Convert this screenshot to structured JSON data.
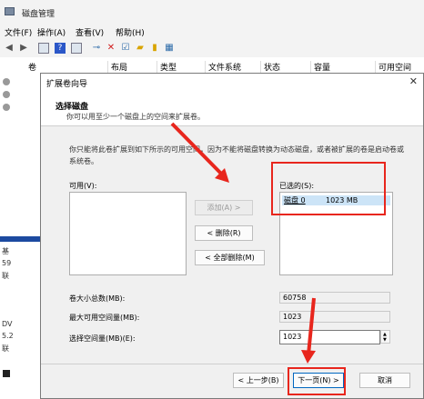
{
  "window": {
    "title": "磁盘管理"
  },
  "menu": [
    "文件(F)",
    "操作(A)",
    "查看(V)",
    "帮助(H)"
  ],
  "toolbar_icons": [
    "back-arrow-icon",
    "forward-arrow-icon",
    "properties-icon",
    "help-icon",
    "connect-icon",
    "delete-icon",
    "check-icon",
    "folder-icon",
    "open-icon",
    "info-icon"
  ],
  "columns": [
    "卷",
    "布局",
    "类型",
    "文件系统",
    "状态",
    "容量",
    "可用空间"
  ],
  "left_pane": {
    "labels": [
      "基",
      "59",
      "联",
      "DV",
      "5.2",
      "联"
    ]
  },
  "dialog": {
    "title": "扩展卷向导",
    "close": "✕",
    "header_title": "选择磁盘",
    "header_sub": "你可以用至少一个磁盘上的空间来扩展卷。",
    "description": "你只能将此卷扩展到如下所示的可用空间，因为不能将磁盘转换为动态磁盘，或者被扩展的卷是启动卷或系统卷。",
    "available_label": "可用(V):",
    "selected_label": "已选的(S):",
    "selected_items": [
      {
        "disk": "磁盘 0",
        "size": "1023 MB"
      }
    ],
    "add_button": "添加(A) >",
    "remove_button": "< 删除(R)",
    "remove_all_button": "< 全部删除(M)",
    "total_label": "卷大小总数(MB):",
    "total_value": "60758",
    "max_label": "最大可用空间量(MB):",
    "max_value": "1023",
    "select_label": "选择空间量(MB)(E):",
    "select_value": "1023",
    "back_button": "< 上一步(B)",
    "next_button": "下一页(N) >",
    "cancel_button": "取消"
  },
  "colors": {
    "annotation_red": "#e8261d",
    "selection_blue": "#cce4f7",
    "desktop_blue": "#1c4aa0"
  }
}
